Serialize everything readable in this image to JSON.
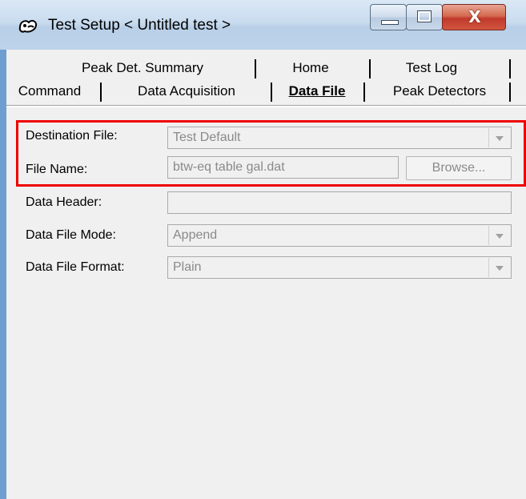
{
  "window": {
    "title": "Test Setup < Untitled test >",
    "close_glyph": "X",
    "accent_color": "#ee0000"
  },
  "tabs": {
    "back_row": [
      {
        "label": "Peak Det. Summary"
      },
      {
        "label": "Home"
      },
      {
        "label": "Test Log"
      }
    ],
    "front_row": [
      {
        "label": "Command"
      },
      {
        "label": "Data Acquisition"
      },
      {
        "label": "Data File",
        "selected": true
      },
      {
        "label": "Peak Detectors"
      }
    ]
  },
  "form": {
    "destination_file": {
      "label": "Destination File:",
      "value": "Test Default"
    },
    "file_name": {
      "label": "File Name:",
      "value": "btw-eq table gal.dat",
      "browse_label": "Browse..."
    },
    "data_header": {
      "label": "Data Header:",
      "value": ""
    },
    "data_file_mode": {
      "label": "Data File Mode:",
      "value": "Append"
    },
    "data_file_format": {
      "label": "Data File Format:",
      "value": "Plain"
    }
  }
}
